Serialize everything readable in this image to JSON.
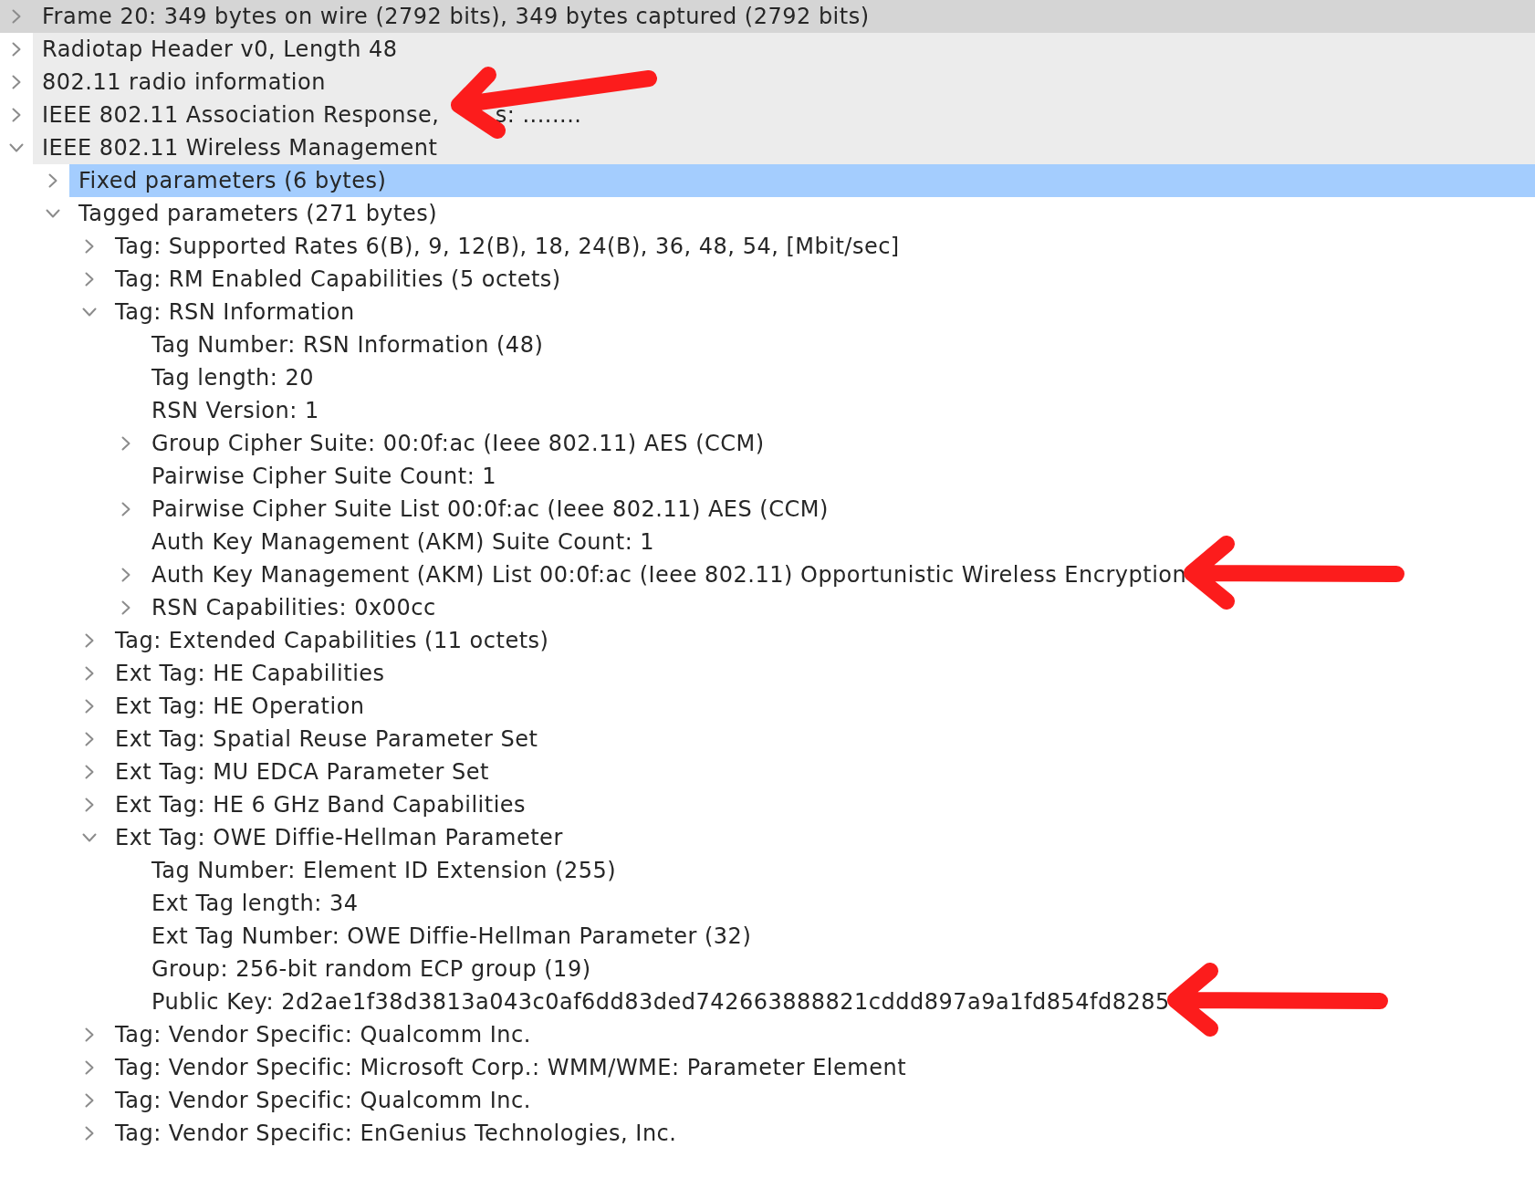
{
  "tree": [
    {
      "label": "Frame 20: 349 bytes on wire (2792 bits), 349 bytes captured (2792 bits)",
      "kind": "branch",
      "expanded": false,
      "selected": false,
      "hovered": true,
      "arrow": false
    },
    {
      "label": "Radiotap Header v0, Length 48",
      "kind": "branch",
      "expanded": false,
      "selected": false,
      "hovered": false,
      "arrow": false
    },
    {
      "label": "802.11 radio information",
      "kind": "branch",
      "expanded": false,
      "selected": false,
      "hovered": false,
      "arrow": false
    },
    {
      "label_parts": [
        "IEEE 802.11 Association Response,",
        "s: ........"
      ],
      "kind": "branch",
      "expanded": false,
      "selected": false,
      "hovered": false,
      "arrow": true
    },
    {
      "label": "IEEE 802.11 Wireless Management",
      "kind": "branch",
      "expanded": true,
      "selected": false,
      "hovered": false,
      "arrow": false,
      "children": [
        {
          "label": "Fixed parameters (6 bytes)",
          "kind": "branch",
          "expanded": false,
          "selected": true,
          "arrow": false
        },
        {
          "label": "Tagged parameters (271 bytes)",
          "kind": "branch",
          "expanded": true,
          "selected": false,
          "arrow": false,
          "children": [
            {
              "label": "Tag: Supported Rates 6(B), 9, 12(B), 18, 24(B), 36, 48, 54, [Mbit/sec]",
              "kind": "branch",
              "expanded": false,
              "selected": false,
              "arrow": false
            },
            {
              "label": "Tag: RM Enabled Capabilities (5 octets)",
              "kind": "branch",
              "expanded": false,
              "selected": false,
              "arrow": false
            },
            {
              "label": "Tag: RSN Information",
              "kind": "branch",
              "expanded": true,
              "selected": false,
              "arrow": false,
              "children": [
                {
                  "label": "Tag Number: RSN Information (48)",
                  "kind": "leaf",
                  "selected": false,
                  "arrow": false
                },
                {
                  "label": "Tag length: 20",
                  "kind": "leaf",
                  "selected": false,
                  "arrow": false
                },
                {
                  "label": "RSN Version: 1",
                  "kind": "leaf",
                  "selected": false,
                  "arrow": false
                },
                {
                  "label": "Group Cipher Suite: 00:0f:ac (Ieee 802.11) AES (CCM)",
                  "kind": "branch",
                  "expanded": false,
                  "selected": false,
                  "arrow": false
                },
                {
                  "label": "Pairwise Cipher Suite Count: 1",
                  "kind": "leaf",
                  "selected": false,
                  "arrow": false
                },
                {
                  "label": "Pairwise Cipher Suite List 00:0f:ac (Ieee 802.11) AES (CCM)",
                  "kind": "branch",
                  "expanded": false,
                  "selected": false,
                  "arrow": false
                },
                {
                  "label": "Auth Key Management (AKM) Suite Count: 1",
                  "kind": "leaf",
                  "selected": false,
                  "arrow": false
                },
                {
                  "label": "Auth Key Management (AKM) List 00:0f:ac (Ieee 802.11) Opportunistic Wireless Encryption",
                  "kind": "branch",
                  "expanded": false,
                  "selected": false,
                  "arrow": true
                },
                {
                  "label": "RSN Capabilities: 0x00cc",
                  "kind": "branch",
                  "expanded": false,
                  "selected": false,
                  "arrow": false
                }
              ]
            },
            {
              "label": "Tag: Extended Capabilities (11 octets)",
              "kind": "branch",
              "expanded": false,
              "selected": false,
              "arrow": false
            },
            {
              "label": "Ext Tag: HE Capabilities",
              "kind": "branch",
              "expanded": false,
              "selected": false,
              "arrow": false
            },
            {
              "label": "Ext Tag: HE Operation",
              "kind": "branch",
              "expanded": false,
              "selected": false,
              "arrow": false
            },
            {
              "label": "Ext Tag: Spatial Reuse Parameter Set",
              "kind": "branch",
              "expanded": false,
              "selected": false,
              "arrow": false
            },
            {
              "label": "Ext Tag: MU EDCA Parameter Set",
              "kind": "branch",
              "expanded": false,
              "selected": false,
              "arrow": false
            },
            {
              "label": "Ext Tag: HE 6 GHz Band Capabilities",
              "kind": "branch",
              "expanded": false,
              "selected": false,
              "arrow": false
            },
            {
              "label": "Ext Tag: OWE Diffie-Hellman Parameter",
              "kind": "branch",
              "expanded": true,
              "selected": false,
              "arrow": false,
              "children": [
                {
                  "label": "Tag Number: Element ID Extension (255)",
                  "kind": "leaf",
                  "selected": false,
                  "arrow": false
                },
                {
                  "label": "Ext Tag length: 34",
                  "kind": "leaf",
                  "selected": false,
                  "arrow": false
                },
                {
                  "label": "Ext Tag Number: OWE Diffie-Hellman Parameter (32)",
                  "kind": "leaf",
                  "selected": false,
                  "arrow": false
                },
                {
                  "label": "Group: 256-bit random ECP group (19)",
                  "kind": "leaf",
                  "selected": false,
                  "arrow": false
                },
                {
                  "label": "Public Key: 2d2ae1f38d3813a043c0af6dd83ded742663888821cddd897a9a1fd854fd8285",
                  "kind": "leaf",
                  "selected": false,
                  "arrow": true
                }
              ]
            },
            {
              "label": "Tag: Vendor Specific: Qualcomm Inc.",
              "kind": "branch",
              "expanded": false,
              "selected": false,
              "arrow": false
            },
            {
              "label": "Tag: Vendor Specific: Microsoft Corp.: WMM/WME: Parameter Element",
              "kind": "branch",
              "expanded": false,
              "selected": false,
              "arrow": false
            },
            {
              "label": "Tag: Vendor Specific: Qualcomm Inc.",
              "kind": "branch",
              "expanded": false,
              "selected": false,
              "arrow": false
            },
            {
              "label": "Tag: Vendor Specific: EnGenius Technologies, Inc.",
              "kind": "branch",
              "expanded": false,
              "selected": false,
              "arrow": false
            }
          ]
        }
      ]
    }
  ]
}
